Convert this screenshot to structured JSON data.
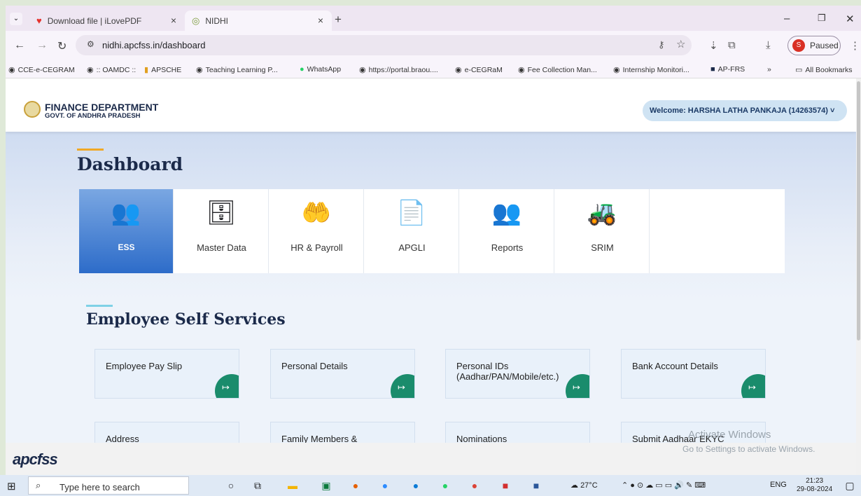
{
  "browser": {
    "tabs": [
      {
        "title": "Download file | iLovePDF",
        "icon": "heart-icon"
      },
      {
        "title": "NIDHI",
        "icon": "nidhi-favicon"
      }
    ],
    "url": "nidhi.apcfss.in/dashboard",
    "profile_initial": "S",
    "profile_status": "Paused",
    "bookmarks": [
      "CCE-e-CEGRAM",
      ":: OAMDC ::",
      "APSCHE",
      "Teaching Learning P...",
      "WhatsApp",
      "https://portal.braou....",
      "e-CEGRaM",
      "Fee Collection Man...",
      "Internship Monitori...",
      "AP-FRS"
    ],
    "bookmarks_more": "»",
    "all_bookmarks": "All Bookmarks"
  },
  "header": {
    "dept": "FINANCE DEPARTMENT",
    "govt": "GOVT. OF ANDHRA PRADESH",
    "welcome": "Welcome: HARSHA LATHA PANKAJA (14263574) ˅"
  },
  "dashboard": {
    "title": "Dashboard",
    "tiles": [
      {
        "label": "ESS",
        "icon": "ess-people-icon",
        "active": true
      },
      {
        "label": "Master Data",
        "icon": "master-data-icon"
      },
      {
        "label": "HR & Payroll",
        "icon": "hr-payroll-icon"
      },
      {
        "label": "APGLI",
        "icon": "apgli-icon"
      },
      {
        "label": "Reports",
        "icon": "reports-icon"
      },
      {
        "label": "SRIM",
        "icon": "srim-excavator-icon"
      }
    ]
  },
  "ess": {
    "title": "Employee Self Services",
    "cards": [
      "Employee Pay Slip",
      "Personal Details",
      "Personal IDs\n(Aadhar/PAN/Mobile/etc.)",
      "Bank Account Details",
      "Address",
      "Family Members &",
      "Nominations",
      "Submit Aadhaar EKYC"
    ]
  },
  "footer": {
    "logo": "apcfss"
  },
  "windows": {
    "activate_title": "Activate Windows",
    "activate_sub": "Go to Settings to activate Windows."
  },
  "taskbar": {
    "search_placeholder": "Type here to search",
    "temp": "27°C",
    "lang": "ENG",
    "time": "21:23",
    "date": "29-08-2024"
  },
  "colors": {
    "accent_orange": "#f0a826",
    "ess_active": "#2d6cc9",
    "card_go": "#1a8c6c"
  }
}
